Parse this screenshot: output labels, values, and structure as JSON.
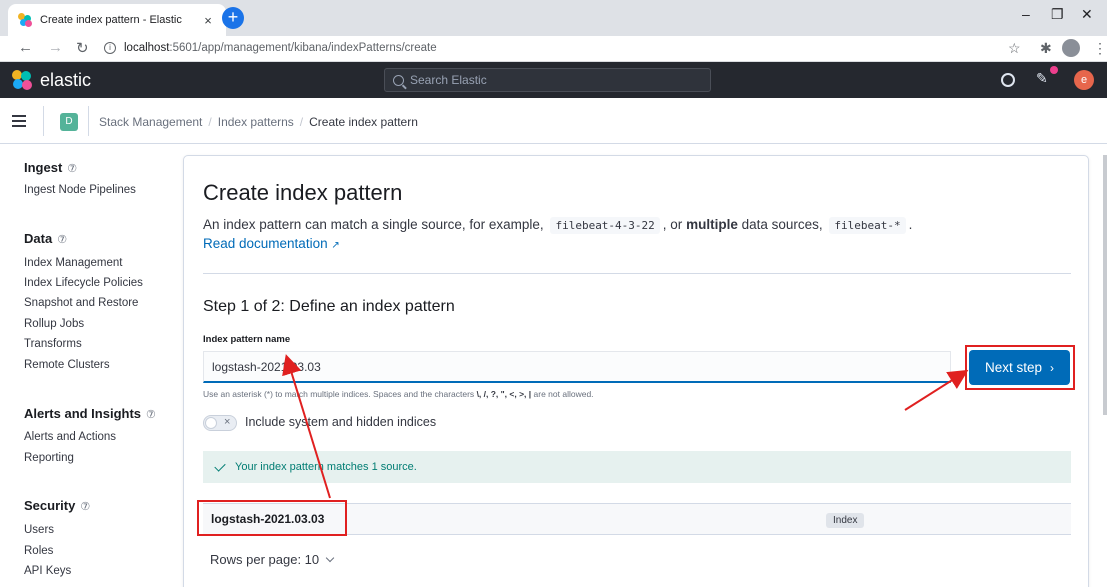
{
  "browser": {
    "tab_title": "Create index pattern - Elastic",
    "tab_close": "×",
    "new_tab": "+",
    "url_host": "localhost",
    "url_path": ":5601/app/management/kibana/indexPatterns/create",
    "url_info": "i",
    "min": "–",
    "restore": "❐",
    "close": "✕"
  },
  "header": {
    "brand": "elastic",
    "search_placeholder": "Search Elastic",
    "user_initial": "e"
  },
  "breadcrumb": {
    "space": "D",
    "items": [
      "Stack Management",
      "Index patterns",
      "Create index pattern"
    ],
    "sep": "/"
  },
  "sidebar": {
    "sections": [
      {
        "title": "Ingest",
        "items": [
          "Ingest Node Pipelines"
        ]
      },
      {
        "title": "Data",
        "items": [
          "Index Management",
          "Index Lifecycle Policies",
          "Snapshot and Restore",
          "Rollup Jobs",
          "Transforms",
          "Remote Clusters"
        ]
      },
      {
        "title": "Alerts and Insights",
        "items": [
          "Alerts and Actions",
          "Reporting"
        ]
      },
      {
        "title": "Security",
        "items": [
          "Users",
          "Roles",
          "API Keys"
        ]
      }
    ],
    "help_glyph": "⑦"
  },
  "main": {
    "title": "Create index pattern",
    "desc_1": "An index pattern can match a single source, for example,",
    "code_1": "filebeat-4-3-22",
    "desc_2": ", or",
    "desc_bold": "multiple",
    "desc_3": "data sources,",
    "code_2": "filebeat-*",
    "desc_4": ".",
    "read_doc": "Read documentation",
    "step_title": "Step 1 of 2: Define an index pattern",
    "field_label": "Index pattern name",
    "field_value": "logstash-2021.03.03",
    "help_1": "Use an asterisk (*) to match multiple indices. Spaces and the characters",
    "help_chars": "\\, /, ?, \", <, >, |",
    "help_2": "are not allowed.",
    "toggle_x": "×",
    "toggle_label": "Include system and hidden indices",
    "callout": "Your index pattern matches 1 source.",
    "row_name": "logstash-2021.03.03",
    "row_badge": "Index",
    "rows_per_page": "Rows per page: 10",
    "next_label": "Next step",
    "next_arrow": "›"
  },
  "colors": {
    "primary": "#006bb8",
    "header_bg": "#25282f",
    "success": "#017d73",
    "annotation_red": "#e02020"
  }
}
